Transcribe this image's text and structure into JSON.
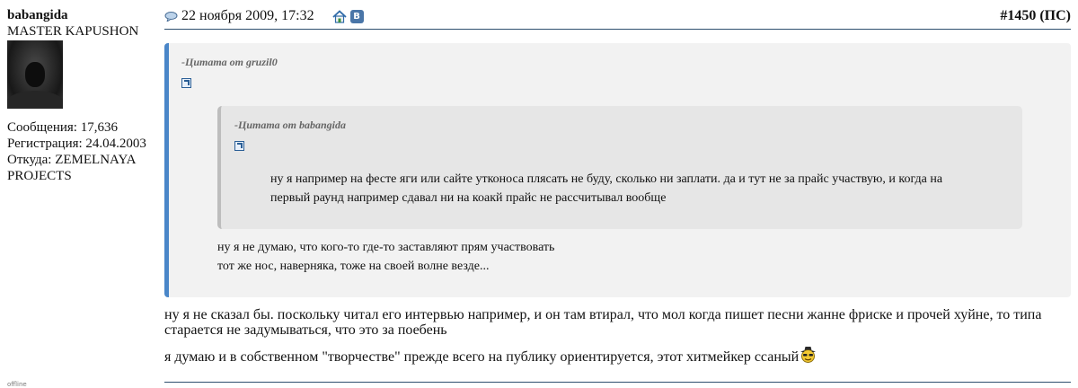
{
  "user": {
    "name": "babangida",
    "title": "MASTER KAPUSHON",
    "posts": "Сообщения: 17,636",
    "registered": "Регистрация: 24.04.2003",
    "location_line1": "Откуда: ZEMELNAYA",
    "location_line2": "PROJECTS",
    "status": "offline"
  },
  "post": {
    "date": "22 ноября 2009, 17:32",
    "number": "#1450",
    "tag": "(ПС)"
  },
  "quote_outer": {
    "header": "-Цитата от gruzil0",
    "text_line1": "ну я не думаю, что кого-то где-то заставляют прям участвовать",
    "text_line2": "тот же нос, наверняка, тоже на своей волне везде..."
  },
  "quote_inner": {
    "header": "-Цитата от babangida",
    "text_line1": "ну я например на фесте яги или сайте утконоса плясать не буду, сколько ни заплати. да и тут не за прайс участвую, и когда на",
    "text_line2": "первый раунд например сдавал ни на коакй прайс не рассчитывал вообще"
  },
  "message": {
    "line1": "ну я не сказал бы. поскольку читал его интервью например, и он там втирал, что мол когда пишет песни жанне фриске и прочей хуйне, то типа",
    "line2": "старается не задумываться, что это за поебень",
    "line3": "я думаю и в собственном \"творчестве\" прежде всего на публику ориентируется, этот хитмейкер ссаный"
  },
  "icons": {
    "vk_letter": "В",
    "header_icons": [
      "speech-bubble-icon",
      "home-icon",
      "vk-icon"
    ],
    "accent": "#4a86c8"
  }
}
